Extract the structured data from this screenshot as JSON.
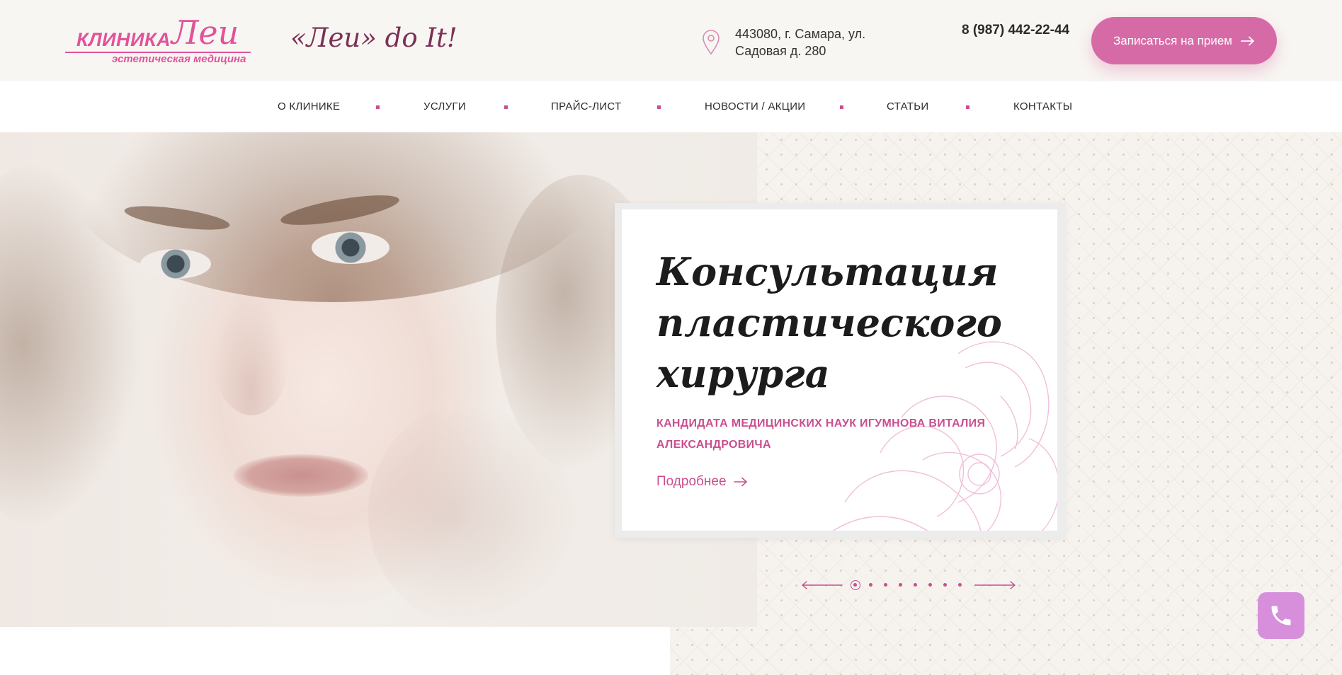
{
  "header": {
    "logo": {
      "name": "КЛИНИКА",
      "script": "Леи",
      "subtitle": "эстетическая медицина"
    },
    "slogan": "«Леи» do It!",
    "address": {
      "line1": "443080, г. Самара, ул.",
      "line2": "Садовая д. 280"
    },
    "phone": "8 (987) 442-22-44",
    "cta_label": "Записаться на прием"
  },
  "nav": {
    "items": [
      {
        "label": "О КЛИНИКЕ"
      },
      {
        "label": "УСЛУГИ"
      },
      {
        "label": "ПРАЙС-ЛИСТ"
      },
      {
        "label": "НОВОСТИ / АКЦИИ"
      },
      {
        "label": "СТАТЬИ"
      },
      {
        "label": "КОНТАКТЫ"
      }
    ]
  },
  "hero": {
    "title": {
      "line1": "Консультация",
      "line2": "пластического",
      "line3": "хирурга"
    },
    "subtitle": {
      "line1": "КАНДИДАТА МЕДИЦИНСКИХ НАУК ИГУМНОВА ВИТАЛИЯ",
      "line2": "АЛЕКСАНДРОВИЧА"
    },
    "more_label": "Подробнее",
    "slides": {
      "total": 8,
      "active": 1
    }
  },
  "icons": {
    "pin": "map-pin-icon",
    "arrow": "arrow-right-icon",
    "phone": "phone-icon"
  },
  "colors": {
    "accent": "#c94f8f",
    "button": "#d66aa6",
    "header_bg": "#f8f6f2",
    "call_button": "#d78fdc"
  }
}
